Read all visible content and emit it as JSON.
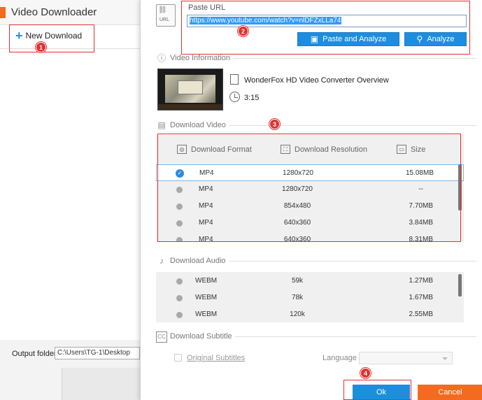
{
  "app": {
    "title": "Video Downloader",
    "new_download_label": "New Download",
    "output_folder_label": "Output folder:",
    "output_folder_value": "C:\\Users\\TG-1\\Desktop"
  },
  "paste": {
    "label": "Paste URL",
    "url": "https://www.youtube.com/watch?v=nlDFZxLLa74",
    "paste_analyze_label": "Paste and Analyze",
    "analyze_label": "Analyze",
    "url_icon_text": "URL"
  },
  "video_info": {
    "section_title": "Video Information",
    "title": "WonderFox HD Video Converter Overview",
    "duration": "3:15"
  },
  "download_video": {
    "section_title": "Download Video",
    "headers": [
      "Download Format",
      "Download Resolution",
      "Size"
    ],
    "rows": [
      {
        "format": "MP4",
        "resolution": "1280x720",
        "size": "15.08MB"
      },
      {
        "format": "MP4",
        "resolution": "1280x720",
        "size": "--"
      },
      {
        "format": "MP4",
        "resolution": "854x480",
        "size": "7.70MB"
      },
      {
        "format": "MP4",
        "resolution": "640x360",
        "size": "3.84MB"
      },
      {
        "format": "MP4",
        "resolution": "640x360",
        "size": "8.31MB"
      }
    ]
  },
  "download_audio": {
    "section_title": "Download Audio",
    "rows": [
      {
        "format": "WEBM",
        "bitrate": "59k",
        "size": "1.27MB"
      },
      {
        "format": "WEBM",
        "bitrate": "78k",
        "size": "1.67MB"
      },
      {
        "format": "WEBM",
        "bitrate": "120k",
        "size": "2.55MB"
      }
    ]
  },
  "subtitle": {
    "section_title": "Download Subtitle",
    "original_label": "Original Subtitles",
    "language_label": "Language",
    "icon_text": "CC"
  },
  "footer": {
    "ok_label": "Ok",
    "cancel_label": "Cancel"
  },
  "steps": [
    "1",
    "2",
    "3",
    "4"
  ],
  "colors": {
    "accent_blue": "#1f8ddd",
    "accent_orange": "#f36b21",
    "highlight_red": "#e03030"
  }
}
